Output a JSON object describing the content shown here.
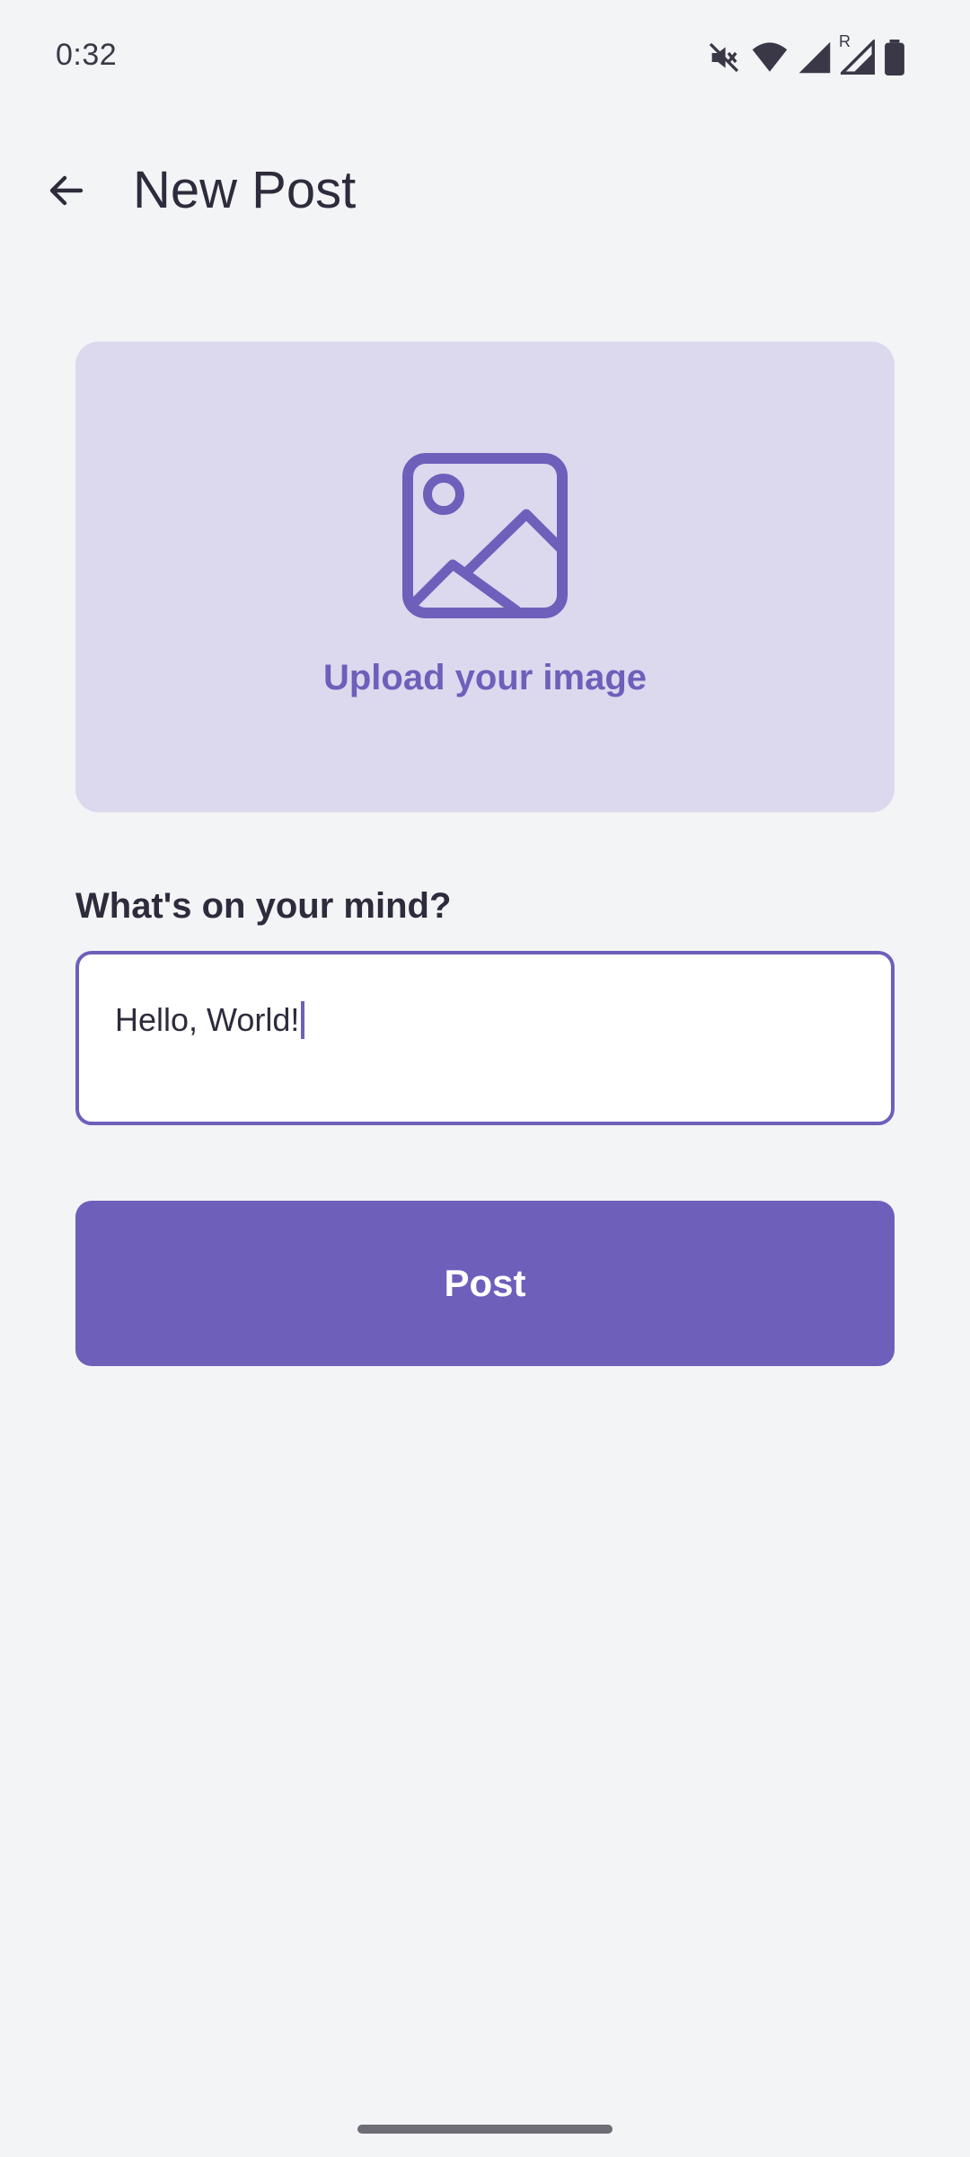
{
  "status_bar": {
    "time": "0:32",
    "icons": [
      "mute-icon",
      "wifi-icon",
      "signal-icon",
      "roaming-signal-icon",
      "battery-icon"
    ],
    "roaming_mark": "R"
  },
  "app_bar": {
    "back_icon": "arrow-back-icon",
    "title": "New Post"
  },
  "upload": {
    "icon": "image-icon",
    "label": "Upload your image"
  },
  "composer": {
    "prompt": "What's on your mind?",
    "value": "Hello, World!"
  },
  "actions": {
    "post_label": "Post"
  },
  "colors": {
    "accent": "#6E5FBB",
    "upload_bg": "#DCD9EE",
    "page_bg": "#F3F4F6",
    "text": "#2E2B3C"
  }
}
